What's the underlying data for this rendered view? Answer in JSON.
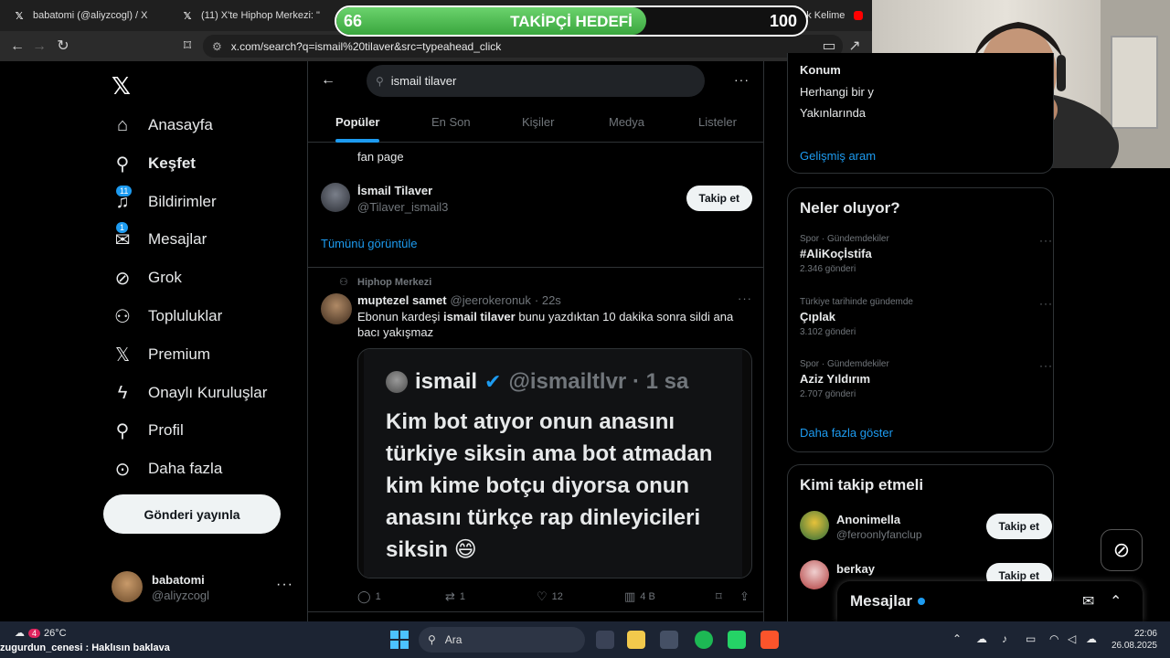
{
  "browser": {
    "tabs": [
      {
        "title": "babatomi (@aliyzcogl) / X"
      },
      {
        "title": "(11) X'te Hiphop Merkezi: \""
      },
      {
        "title": "Wordle Türkçe - Günlük Kelime"
      }
    ],
    "url": "x.com/search?q=ismail%20tilaver&src=typeahead_click"
  },
  "goal": {
    "current": "66",
    "target": "100",
    "label": "TAKİPÇİ HEDEFİ",
    "progress": 0.66
  },
  "sidebar": {
    "items": [
      {
        "label": "Anasayfa",
        "icon": "home-icon"
      },
      {
        "label": "Keşfet",
        "icon": "search-icon",
        "active": true
      },
      {
        "label": "Bildirimler",
        "icon": "bell-icon",
        "badge": "11"
      },
      {
        "label": "Mesajlar",
        "icon": "mail-icon",
        "badge": "1"
      },
      {
        "label": "Grok",
        "icon": "grok-icon"
      },
      {
        "label": "Topluluklar",
        "icon": "communities-icon"
      },
      {
        "label": "Premium",
        "icon": "x-icon"
      },
      {
        "label": "Onaylı Kuruluşlar",
        "icon": "lightning-icon"
      },
      {
        "label": "Profil",
        "icon": "person-icon"
      },
      {
        "label": "Daha fazla",
        "icon": "more-circle-icon"
      }
    ],
    "post_button": "Gönderi yayınla",
    "account": {
      "name": "babatomi",
      "handle": "@aliyzcogl"
    }
  },
  "main": {
    "search_value": "ismail tilaver",
    "tabs": [
      {
        "label": "Popüler",
        "active": true
      },
      {
        "label": "En Son"
      },
      {
        "label": "Kişiler"
      },
      {
        "label": "Medya"
      },
      {
        "label": "Listeler"
      }
    ],
    "fan_page_text": "fan page",
    "user_result": {
      "name": "İsmail Tilaver",
      "handle": "@Tilaver_ismail3",
      "follow_label": "Takip et"
    },
    "show_all": "Tümünü görüntüle",
    "tweet": {
      "community": "Hiphop Merkezi",
      "name": "muptezel samet",
      "handle": "@jeerokeronuk",
      "time": "· 22s",
      "text_pre": "Ebonun kardeşi ",
      "text_bold": "ismail tilaver",
      "text_post": "  bunu yazdıktan 10 dakika sonra sildi ana bacı yakışmaz",
      "media": {
        "name": "ismail",
        "handle": "@ismailtlvr · 1 sa",
        "text": "Kim bot atıyor onun anasını türkiye siksin ama bot atmadan kim kime botçu diyorsa onun anasını türkçe rap dinleyicileri siksin 😄"
      },
      "stats": {
        "replies": "1",
        "reposts": "1",
        "likes": "12",
        "views": "4 B"
      }
    }
  },
  "right": {
    "location": {
      "title": "Konum",
      "line1": "Herhangi bir y",
      "line2": "Yakınlarında",
      "advanced": "Gelişmiş aram"
    },
    "trends_title": "Neler oluyor?",
    "trends": [
      {
        "meta": "Spor · Gündemdekiler",
        "name": "#AliKoçİstifa",
        "count": "2.346 gönderi"
      },
      {
        "meta": "Türkiye tarihinde gündemde",
        "name": "Çıplak",
        "count": "3.102 gönderi"
      },
      {
        "meta": "Spor · Gündemdekiler",
        "name": "Aziz Yıldırım",
        "count": "2.707 gönderi"
      }
    ],
    "show_more": "Daha fazla göster",
    "who_title": "Kimi takip etmeli",
    "who": [
      {
        "name": "Anonimella",
        "handle": "@feroonlyfanclup",
        "follow_label": "Takip et"
      },
      {
        "name": "berkay",
        "handle": "",
        "follow_label": "Takip et"
      }
    ]
  },
  "messages_drawer": {
    "title": "Mesajlar"
  },
  "taskbar": {
    "weather": "26°C",
    "weather_badge": "4",
    "ticker": "zugurdun_cenesi : Haklısın baklava",
    "search_placeholder": "Ara",
    "time": "22:06",
    "date": "26.08.2025"
  },
  "colors": {
    "accent": "#1d9bf0",
    "background": "#000000",
    "goal_fill": "#4cbb4f"
  }
}
